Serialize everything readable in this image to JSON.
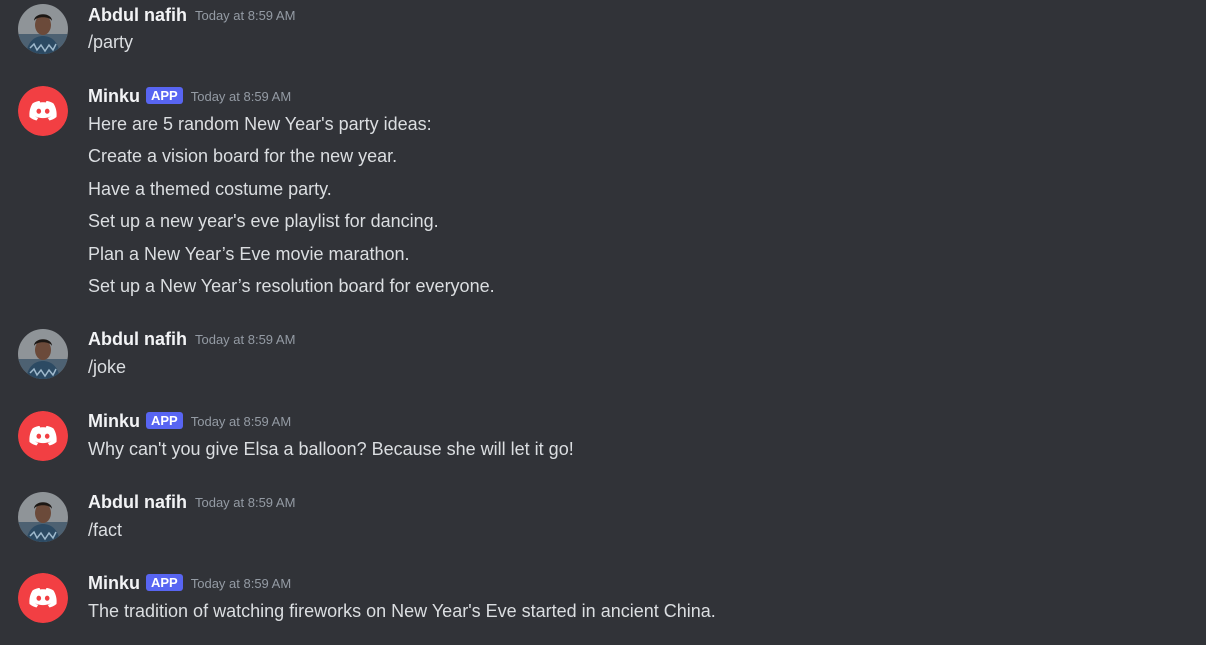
{
  "colors": {
    "background": "#313338",
    "bot_avatar": "#f23f43",
    "app_badge": "#5865f2",
    "text": "#dbdee1",
    "timestamp": "#949ba4"
  },
  "messages": [
    {
      "author": "Abdul nafih",
      "timestamp": "Today at 8:59 AM",
      "lines": [
        "/party"
      ]
    },
    {
      "author": "Minku",
      "badge": "APP",
      "timestamp": "Today at 8:59 AM",
      "lines": [
        "Here are 5 random New Year's party ideas:",
        "Create a vision board for the new year.",
        "Have a themed costume party.",
        "Set up a new year's eve playlist for dancing.",
        "Plan a New Year’s Eve movie marathon.",
        "Set up a New Year’s resolution board for everyone."
      ]
    },
    {
      "author": "Abdul nafih",
      "timestamp": "Today at 8:59 AM",
      "lines": [
        "/joke"
      ]
    },
    {
      "author": "Minku",
      "badge": "APP",
      "timestamp": "Today at 8:59 AM",
      "lines": [
        "Why can't you give Elsa a balloon? Because she will let it go!"
      ]
    },
    {
      "author": "Abdul nafih",
      "timestamp": "Today at 8:59 AM",
      "lines": [
        "/fact"
      ]
    },
    {
      "author": "Minku",
      "badge": "APP",
      "timestamp": "Today at 8:59 AM",
      "lines": [
        "The tradition of watching fireworks on New Year's Eve started in ancient China."
      ]
    }
  ]
}
